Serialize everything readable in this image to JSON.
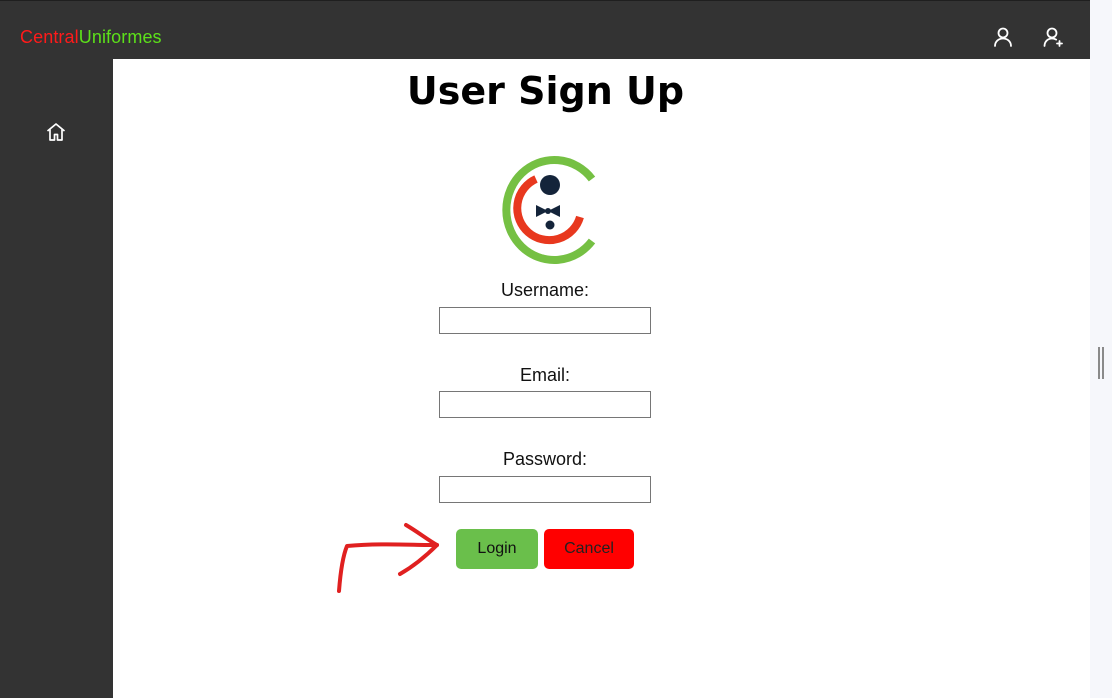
{
  "header": {
    "brand_part1": "Central",
    "brand_part2": "Uniformes",
    "icons": [
      "user-icon",
      "user-add-icon"
    ]
  },
  "sidebar": {
    "items": [
      {
        "icon": "home-icon"
      }
    ]
  },
  "main": {
    "title": "User Sign Up",
    "logo": "company-logo",
    "fields": [
      {
        "label": "Username:",
        "value": ""
      },
      {
        "label": "Email:",
        "value": ""
      },
      {
        "label": "Password:",
        "value": ""
      }
    ],
    "login_label": "Login",
    "cancel_label": "Cancel"
  },
  "colors": {
    "bar": "#333333",
    "brand_red": "#ff1a1a",
    "brand_green": "#5ce01a",
    "login_bg": "#6abf4b",
    "cancel_bg": "#ff0000",
    "annotation": "#e02020"
  }
}
